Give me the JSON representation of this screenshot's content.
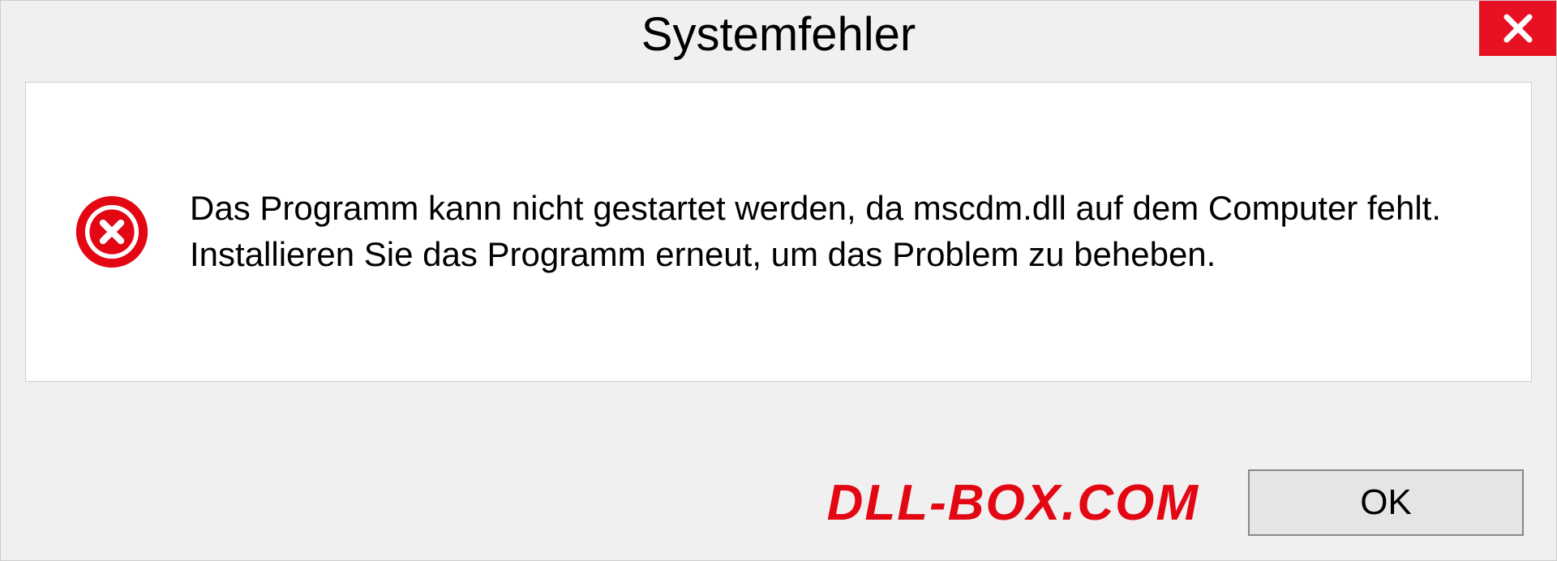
{
  "dialog": {
    "title": "Systemfehler",
    "message": "Das Programm kann nicht gestartet werden, da mscdm.dll auf dem Computer fehlt. Installieren Sie das Programm erneut, um das Problem zu beheben.",
    "ok_label": "OK"
  },
  "watermark": "DLL-BOX.COM",
  "colors": {
    "close_bg": "#e81123",
    "error_icon": "#e30613",
    "watermark": "#e30613"
  }
}
